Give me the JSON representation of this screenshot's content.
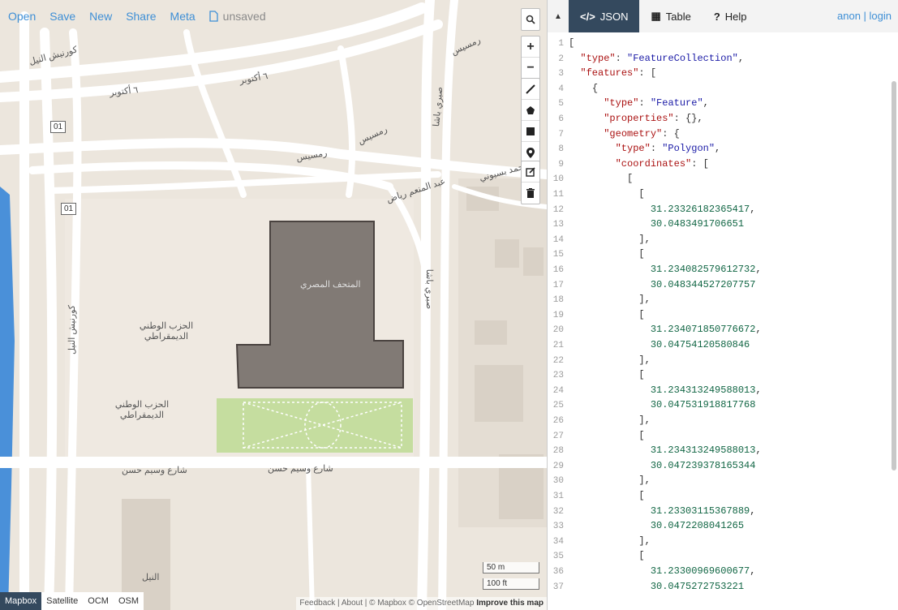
{
  "menu": {
    "items": [
      "Open",
      "Save",
      "New",
      "Share",
      "Meta"
    ],
    "status": "unsaved"
  },
  "map": {
    "labels": [
      "كورنيش النيل",
      "٦ أكتوبر",
      "رمسيس",
      "محمد بسيوني",
      "عبد المنعم رياض",
      "المتحف المصري",
      "الحزب الوطني الديمقراطي",
      "شارع وسيم حسن",
      "صبري باشا",
      "النيل"
    ],
    "route_shield": "01",
    "scale": {
      "metric": "50 m",
      "imperial": "100 ft"
    },
    "layers": [
      "Mapbox",
      "Satellite",
      "OCM",
      "OSM"
    ],
    "active_layer": "Mapbox",
    "attribution": "Feedback | About | © Mapbox © OpenStreetMap",
    "improve": "Improve this map"
  },
  "pane": {
    "tabs": [
      {
        "label": "JSON",
        "glyph": "</>"
      },
      {
        "label": "Table",
        "glyph": "▦"
      },
      {
        "label": "Help",
        "glyph": "?"
      }
    ],
    "user": "anon | login"
  },
  "code_lines": [
    {
      "n": 1,
      "indent": 0,
      "tokens": [
        [
          "p",
          "["
        ]
      ]
    },
    {
      "n": 2,
      "indent": 2,
      "tokens": [
        [
          "k",
          "\"type\""
        ],
        [
          "p",
          ": "
        ],
        [
          "s",
          "\"FeatureCollection\""
        ],
        [
          "p",
          ","
        ]
      ]
    },
    {
      "n": 3,
      "indent": 2,
      "tokens": [
        [
          "k",
          "\"features\""
        ],
        [
          "p",
          ": ["
        ]
      ]
    },
    {
      "n": 4,
      "indent": 4,
      "tokens": [
        [
          "p",
          "{"
        ]
      ]
    },
    {
      "n": 5,
      "indent": 6,
      "tokens": [
        [
          "k",
          "\"type\""
        ],
        [
          "p",
          ": "
        ],
        [
          "s",
          "\"Feature\""
        ],
        [
          "p",
          ","
        ]
      ]
    },
    {
      "n": 6,
      "indent": 6,
      "tokens": [
        [
          "k",
          "\"properties\""
        ],
        [
          "p",
          ": {},"
        ]
      ]
    },
    {
      "n": 7,
      "indent": 6,
      "tokens": [
        [
          "k",
          "\"geometry\""
        ],
        [
          "p",
          ": {"
        ]
      ]
    },
    {
      "n": 8,
      "indent": 8,
      "tokens": [
        [
          "k",
          "\"type\""
        ],
        [
          "p",
          ": "
        ],
        [
          "s",
          "\"Polygon\""
        ],
        [
          "p",
          ","
        ]
      ]
    },
    {
      "n": 9,
      "indent": 8,
      "tokens": [
        [
          "k",
          "\"coordinates\""
        ],
        [
          "p",
          ": ["
        ]
      ]
    },
    {
      "n": 10,
      "indent": 10,
      "tokens": [
        [
          "p",
          "["
        ]
      ]
    },
    {
      "n": 11,
      "indent": 12,
      "tokens": [
        [
          "p",
          "["
        ]
      ]
    },
    {
      "n": 12,
      "indent": 14,
      "tokens": [
        [
          "n",
          "31.23326182365417"
        ],
        [
          "p",
          ","
        ]
      ]
    },
    {
      "n": 13,
      "indent": 14,
      "tokens": [
        [
          "n",
          "30.0483491706651"
        ]
      ]
    },
    {
      "n": 14,
      "indent": 12,
      "tokens": [
        [
          "p",
          "],"
        ]
      ]
    },
    {
      "n": 15,
      "indent": 12,
      "tokens": [
        [
          "p",
          "["
        ]
      ]
    },
    {
      "n": 16,
      "indent": 14,
      "tokens": [
        [
          "n",
          "31.234082579612732"
        ],
        [
          "p",
          ","
        ]
      ]
    },
    {
      "n": 17,
      "indent": 14,
      "tokens": [
        [
          "n",
          "30.048344527207757"
        ]
      ]
    },
    {
      "n": 18,
      "indent": 12,
      "tokens": [
        [
          "p",
          "],"
        ]
      ]
    },
    {
      "n": 19,
      "indent": 12,
      "tokens": [
        [
          "p",
          "["
        ]
      ]
    },
    {
      "n": 20,
      "indent": 14,
      "tokens": [
        [
          "n",
          "31.234071850776672"
        ],
        [
          "p",
          ","
        ]
      ]
    },
    {
      "n": 21,
      "indent": 14,
      "tokens": [
        [
          "n",
          "30.04754120580846"
        ]
      ]
    },
    {
      "n": 22,
      "indent": 12,
      "tokens": [
        [
          "p",
          "],"
        ]
      ]
    },
    {
      "n": 23,
      "indent": 12,
      "tokens": [
        [
          "p",
          "["
        ]
      ]
    },
    {
      "n": 24,
      "indent": 14,
      "tokens": [
        [
          "n",
          "31.234313249588013"
        ],
        [
          "p",
          ","
        ]
      ]
    },
    {
      "n": 25,
      "indent": 14,
      "tokens": [
        [
          "n",
          "30.047531918817768"
        ]
      ]
    },
    {
      "n": 26,
      "indent": 12,
      "tokens": [
        [
          "p",
          "],"
        ]
      ]
    },
    {
      "n": 27,
      "indent": 12,
      "tokens": [
        [
          "p",
          "["
        ]
      ]
    },
    {
      "n": 28,
      "indent": 14,
      "tokens": [
        [
          "n",
          "31.234313249588013"
        ],
        [
          "p",
          ","
        ]
      ]
    },
    {
      "n": 29,
      "indent": 14,
      "tokens": [
        [
          "n",
          "30.047239378165344"
        ]
      ]
    },
    {
      "n": 30,
      "indent": 12,
      "tokens": [
        [
          "p",
          "],"
        ]
      ]
    },
    {
      "n": 31,
      "indent": 12,
      "tokens": [
        [
          "p",
          "["
        ]
      ]
    },
    {
      "n": 32,
      "indent": 14,
      "tokens": [
        [
          "n",
          "31.23303115367889"
        ],
        [
          "p",
          ","
        ]
      ]
    },
    {
      "n": 33,
      "indent": 14,
      "tokens": [
        [
          "n",
          "30.0472208041265"
        ]
      ]
    },
    {
      "n": 34,
      "indent": 12,
      "tokens": [
        [
          "p",
          "],"
        ]
      ]
    },
    {
      "n": 35,
      "indent": 12,
      "tokens": [
        [
          "p",
          "["
        ]
      ]
    },
    {
      "n": 36,
      "indent": 14,
      "tokens": [
        [
          "n",
          "31.23300969600677"
        ],
        [
          "p",
          ","
        ]
      ]
    },
    {
      "n": 37,
      "indent": 14,
      "tokens": [
        [
          "n",
          "30.0475272753221"
        ]
      ]
    }
  ],
  "colors": {
    "accent": "#3e8fd6",
    "tab_active": "#34495e",
    "polygon_fill": "#6d6661",
    "park": "#c5dd9f",
    "water": "#4a90d9"
  }
}
